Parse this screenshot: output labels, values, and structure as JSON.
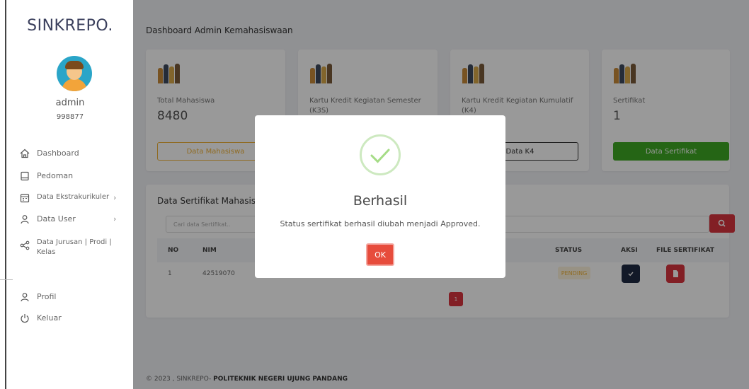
{
  "brand": "SINKREPO.",
  "user": {
    "name": "admin",
    "id": "998877"
  },
  "nav": {
    "dashboard": "Dashboard",
    "pedoman": "Pedoman",
    "ekstra": "Data Ekstrakurikuler",
    "user": "Data User",
    "jurusan_line1": "Data Jurusan | Prodi |",
    "jurusan_line2": "Kelas",
    "profil": "Profil",
    "keluar": "Keluar",
    "chevron": "›"
  },
  "header": {
    "title": "Dashboard Admin Kemahasiswaan"
  },
  "cards": [
    {
      "label": "Total Mahasiswa",
      "value": "8480",
      "button": "Data Mahasiswa"
    },
    {
      "label_line1": "Kartu Kredit Kegiatan Semester",
      "label_line2": "(K3S)",
      "button": ""
    },
    {
      "label_line1": "Kartu Kredit Kegiatan Kumulatif",
      "label_line2": "(K4)",
      "button": "Data K4"
    },
    {
      "label": "Sertifikat",
      "value": "1",
      "button": "Data Sertifikat"
    }
  ],
  "table": {
    "title": "Data Sertifikat Mahasisw",
    "search_placeholder": "Cari data Sertifikat..",
    "columns": {
      "no": "NO",
      "nim": "NIM",
      "status": "STATUS",
      "aksi": "AKSI",
      "file": "FILE SERTIFIKAT"
    },
    "rows": [
      {
        "no": "1",
        "nim": "42519070",
        "status": "PENDING"
      }
    ],
    "page": "1"
  },
  "footer": {
    "prefix": "© 2023 , SINKREPO- ",
    "org": "POLITEKNIK NEGERI UJUNG PANDANG"
  },
  "modal": {
    "title": "Berhasil",
    "message": "Status sertifikat berhasil diubah menjadi Approved.",
    "ok": "OK"
  },
  "colors": {
    "accent_red": "#d9353f",
    "success_green": "#3ea823",
    "warning_orange": "#f0b33a",
    "dark_navy": "#1f2a44"
  },
  "icons": {
    "dashboard": "home-icon",
    "pedoman": "book-icon",
    "ekstra": "calendar-icon",
    "user": "user-icon",
    "jurusan": "share-icon",
    "profil": "user-icon",
    "keluar": "power-icon",
    "search": "search-icon",
    "check": "check-icon",
    "file": "file-icon",
    "success": "check-circle-icon"
  }
}
